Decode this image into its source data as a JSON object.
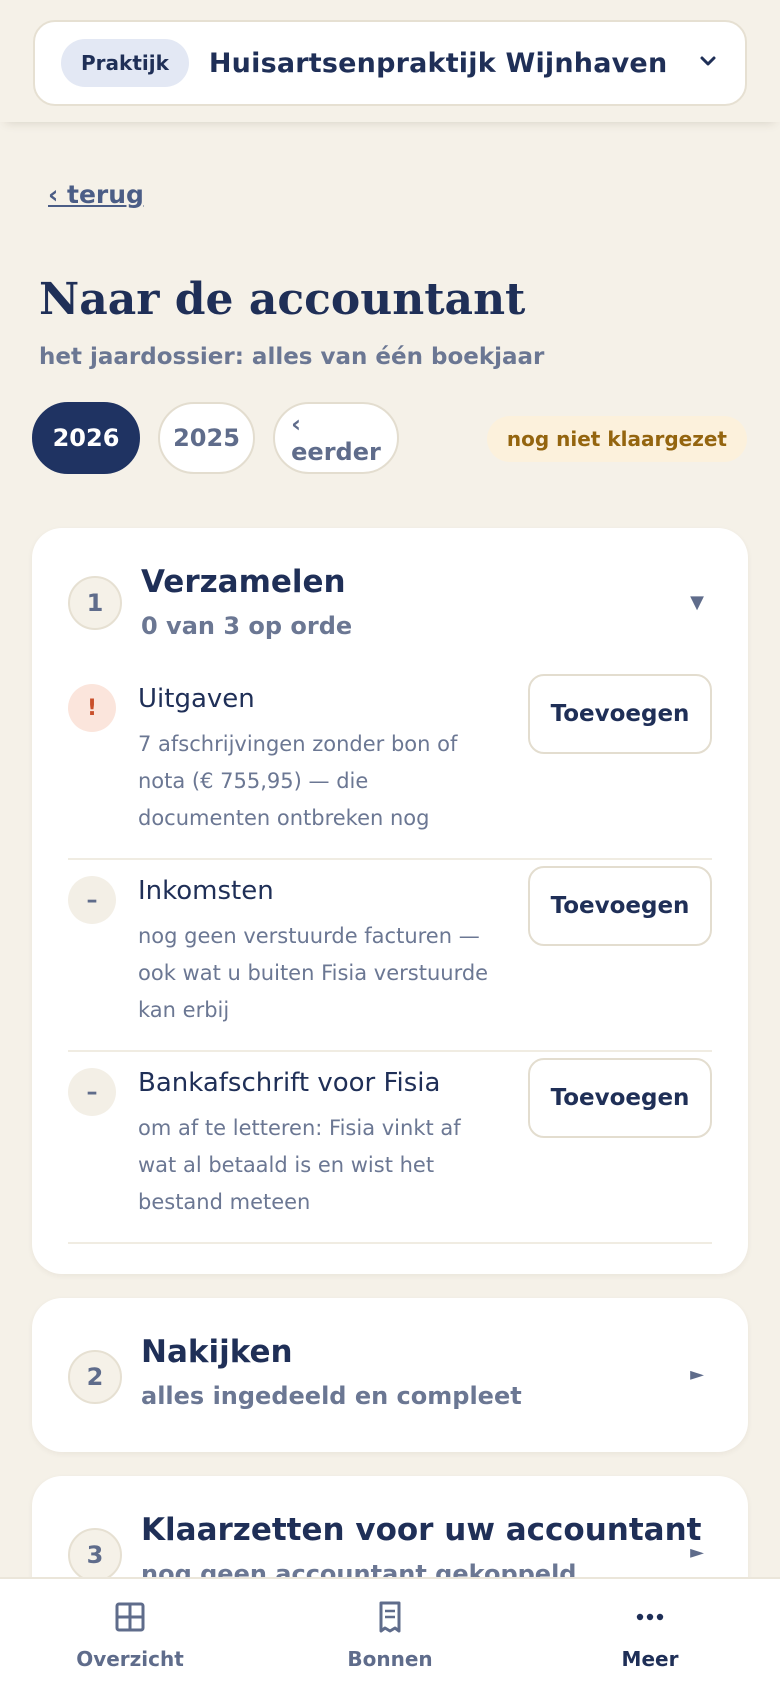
{
  "header": {
    "badge": "Praktijk",
    "practice_name": "Huisartsenpraktijk Wijnhaven",
    "dropdown_icon": "chevron-down-icon"
  },
  "back_link": "‹ terug",
  "page": {
    "title": "Naar de accountant",
    "subtitle": "het jaardossier: alles van één boekjaar"
  },
  "years": [
    {
      "label": "2026",
      "active": true
    },
    {
      "label": "2025",
      "active": false
    },
    {
      "label": "‹ eerder",
      "active": false
    }
  ],
  "status": "nog niet klaargezet",
  "steps": [
    {
      "number": "1",
      "title": "Verzamelen",
      "subtitle": "0 van 3 op orde",
      "toggle": "▼",
      "expanded": true,
      "items": [
        {
          "icon": "!",
          "kind": "warning",
          "title": "Uitgaven",
          "description": "7 afschrijvingen zonder bon of nota (€ 755,95) — die documenten ontbreken nog",
          "button": "Toevoegen"
        },
        {
          "icon": "–",
          "kind": "neutral",
          "title": "Inkomsten",
          "description": "nog geen verstuurde facturen — ook wat u buiten Fisia verstuurde kan erbij",
          "button": "Toevoegen"
        },
        {
          "icon": "–",
          "kind": "neutral",
          "title": "Bankafschrift voor Fisia",
          "description": "om af te letteren: Fisia vinkt af wat al betaald is en wist het bestand meteen",
          "button": "Toevoegen"
        }
      ]
    },
    {
      "number": "2",
      "title": "Nakijken",
      "subtitle": "alles ingedeeld en compleet",
      "toggle": "►",
      "expanded": false
    },
    {
      "number": "3",
      "title": "Klaarzetten voor uw accountant",
      "subtitle": "nog geen accountant gekoppeld",
      "toggle": "►",
      "expanded": false
    }
  ],
  "nav": [
    {
      "label": "Overzicht",
      "icon": "grid-icon",
      "active": false
    },
    {
      "label": "Bonnen",
      "icon": "receipt-icon",
      "active": false
    },
    {
      "label": "Meer",
      "icon": "more-dots-icon",
      "active": true
    }
  ],
  "colors": {
    "background": "#f5f1e8",
    "primary": "#1f3362",
    "warning": "#c9502b",
    "status_text": "#94650f"
  }
}
